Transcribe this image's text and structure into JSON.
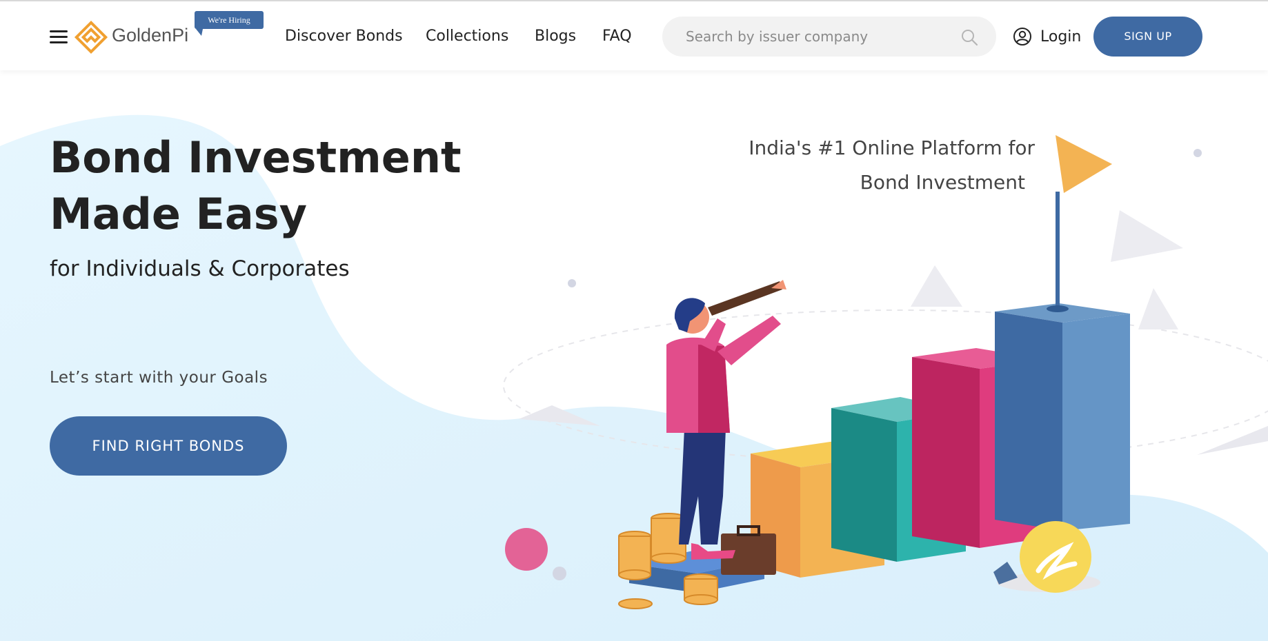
{
  "header": {
    "brand": "GoldenPi",
    "hiring_badge": "We're Hiring",
    "nav": [
      {
        "label": "Discover Bonds"
      },
      {
        "label": "Collections"
      },
      {
        "label": "Blogs"
      },
      {
        "label": "FAQ"
      }
    ],
    "search": {
      "placeholder": "Search by issuer company",
      "value": ""
    },
    "login_label": "Login",
    "signup_label": "SIGN UP"
  },
  "hero": {
    "title_line1": "Bond Investment",
    "title_line2": "Made Easy",
    "subtitle": "for Individuals & Corporates",
    "goals_text": "Let’s start with your Goals",
    "cta_label": "FIND RIGHT BONDS",
    "tagline_line1": "India's #1 Online Platform for",
    "tagline_line2": "Bond Investment"
  },
  "colors": {
    "brand_blue": "#3f6aa3",
    "logo_orange": "#f0a030",
    "hero_wave": "#e2f4fd"
  },
  "icons": [
    "hamburger-menu-icon",
    "goldenpi-logo",
    "search-icon",
    "user-circle-icon"
  ]
}
